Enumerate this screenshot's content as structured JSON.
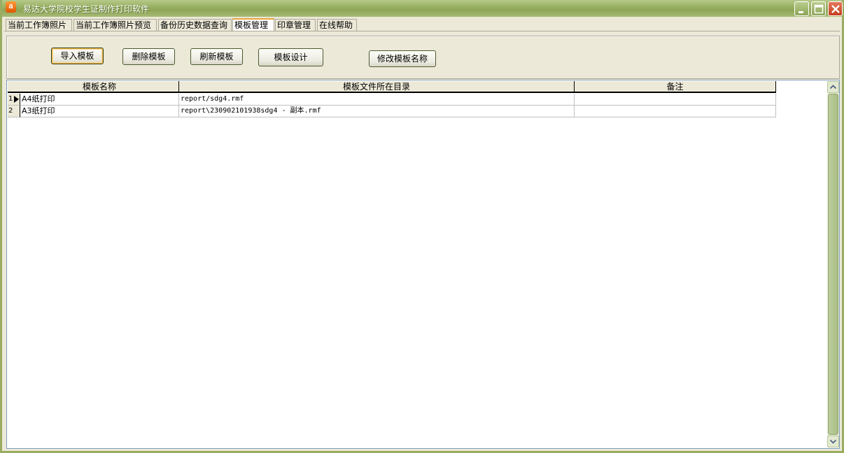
{
  "window": {
    "title": "易达大学院校学生证制作打印软件",
    "icon_letter": "a",
    "controls": {
      "minimize": "minimize-icon",
      "maximize": "maximize-icon",
      "close": "close-icon"
    }
  },
  "tabs": [
    {
      "label": "当前工作簿照片",
      "active": false
    },
    {
      "label": "当前工作簿照片预览",
      "active": false
    },
    {
      "label": "备份历史数据查询",
      "active": false
    },
    {
      "label": "模板管理",
      "active": true
    },
    {
      "label": "印章管理",
      "active": false
    },
    {
      "label": "在线帮助",
      "active": false
    }
  ],
  "toolbar": {
    "import_label": "导入模板",
    "delete_label": "删除模板",
    "refresh_label": "刷新模板",
    "design_label": "模板设计",
    "rename_label": "修改模板名称"
  },
  "grid": {
    "columns": [
      "模板名称",
      "模板文件所在目录",
      "备注"
    ],
    "rows": [
      {
        "index": "1",
        "name": "A4纸打印",
        "path": "report/sdg4.rmf",
        "note": ""
      },
      {
        "index": "2",
        "name": "A3纸打印",
        "path": "report\\230902101938sdg4 - 副本.rmf",
        "note": ""
      }
    ]
  },
  "colors": {
    "titlebar": "#98b162",
    "window_border": "#9aac62",
    "face": "#ece9d8",
    "active_tab_accent": "#e6a43c"
  }
}
